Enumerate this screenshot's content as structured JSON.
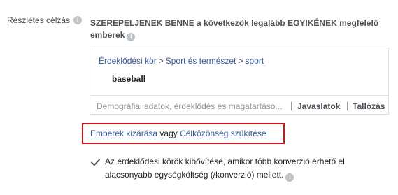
{
  "section": {
    "label": "Részletes célzás",
    "heading": "SZEREPELJENEK BENNE a következők legalább EGYIKÉNEK megfelelő emberek"
  },
  "targeting": {
    "breadcrumb": [
      "Érdeklődési kör",
      "Sport és természet",
      "sport"
    ],
    "breadcrumb_separator": ">",
    "selected_item": "baseball",
    "search_placeholder": "Demográfiai adatok, érdeklődés és magatartáso...",
    "suggestions_label": "Javaslatok",
    "browse_label": "Tallózás"
  },
  "exclusion": {
    "exclude_link": "Emberek kizárása",
    "connector": "vagy",
    "narrow_link": "Célközönség szűkítése",
    "highlight_color": "#d0121b"
  },
  "expansion": {
    "checked": true,
    "label": "Az érdeklődési körök kibővítése, amikor több konverzió érhető el alacsonyabb egységköltség (/konverzió) mellett."
  },
  "icons": {
    "info_icon_glyph": "i",
    "checkmark": "check-icon"
  },
  "colors": {
    "link": "#365899",
    "text": "#1d2129",
    "muted": "#90949c",
    "border": "#dddfe2"
  }
}
